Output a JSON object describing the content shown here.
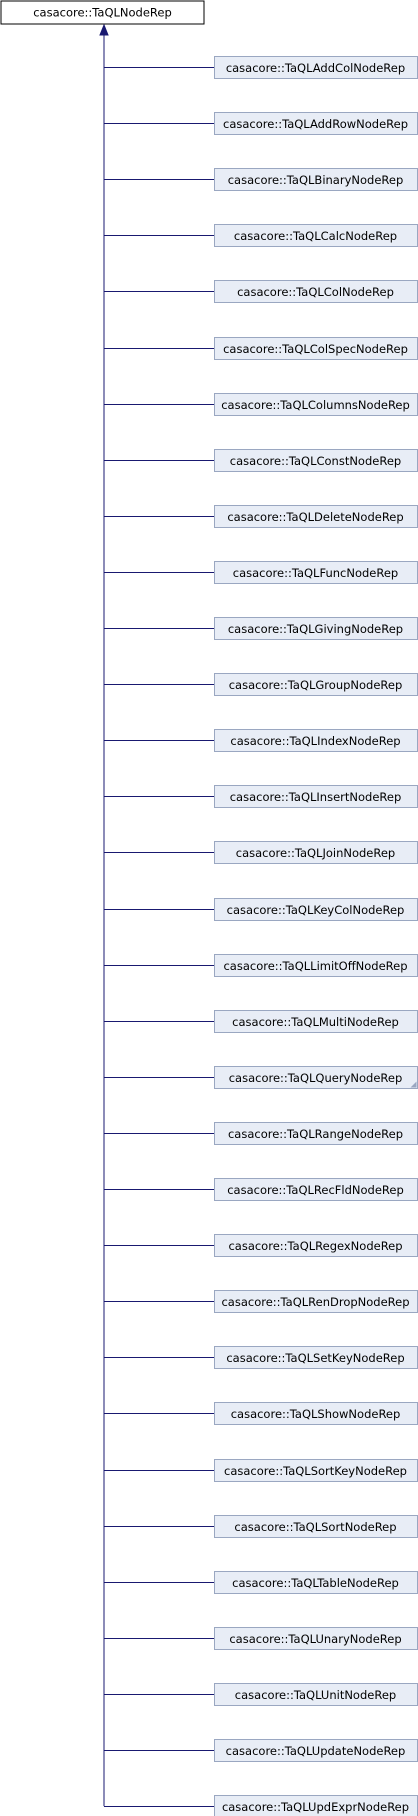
{
  "colors": {
    "edge": "#191970",
    "base_fill": "#ffffff",
    "base_border": "#000000",
    "child_fill": "#e8edf6",
    "child_border": "#9aa7c1",
    "text": "#000000"
  },
  "base_class": "casacore::TaQLNodeRep",
  "derived_classes": [
    "casacore::TaQLAddColNodeRep",
    "casacore::TaQLAddRowNodeRep",
    "casacore::TaQLBinaryNodeRep",
    "casacore::TaQLCalcNodeRep",
    "casacore::TaQLColNodeRep",
    "casacore::TaQLColSpecNodeRep",
    "casacore::TaQLColumnsNodeRep",
    "casacore::TaQLConstNodeRep",
    "casacore::TaQLDeleteNodeRep",
    "casacore::TaQLFuncNodeRep",
    "casacore::TaQLGivingNodeRep",
    "casacore::TaQLGroupNodeRep",
    "casacore::TaQLIndexNodeRep",
    "casacore::TaQLInsertNodeRep",
    "casacore::TaQLJoinNodeRep",
    "casacore::TaQLKeyColNodeRep",
    "casacore::TaQLLimitOffNodeRep",
    "casacore::TaQLMultiNodeRep",
    "casacore::TaQLQueryNodeRep",
    "casacore::TaQLRangeNodeRep",
    "casacore::TaQLRecFldNodeRep",
    "casacore::TaQLRegexNodeRep",
    "casacore::TaQLRenDropNodeRep",
    "casacore::TaQLSetKeyNodeRep",
    "casacore::TaQLShowNodeRep",
    "casacore::TaQLSortKeyNodeRep",
    "casacore::TaQLSortNodeRep",
    "casacore::TaQLTableNodeRep",
    "casacore::TaQLUnaryNodeRep",
    "casacore::TaQLUnitNodeRep",
    "casacore::TaQLUpdateNodeRep",
    "casacore::TaQLUpdExprNodeRep"
  ],
  "folded_marker_on": "casacore::TaQLQueryNodeRep"
}
